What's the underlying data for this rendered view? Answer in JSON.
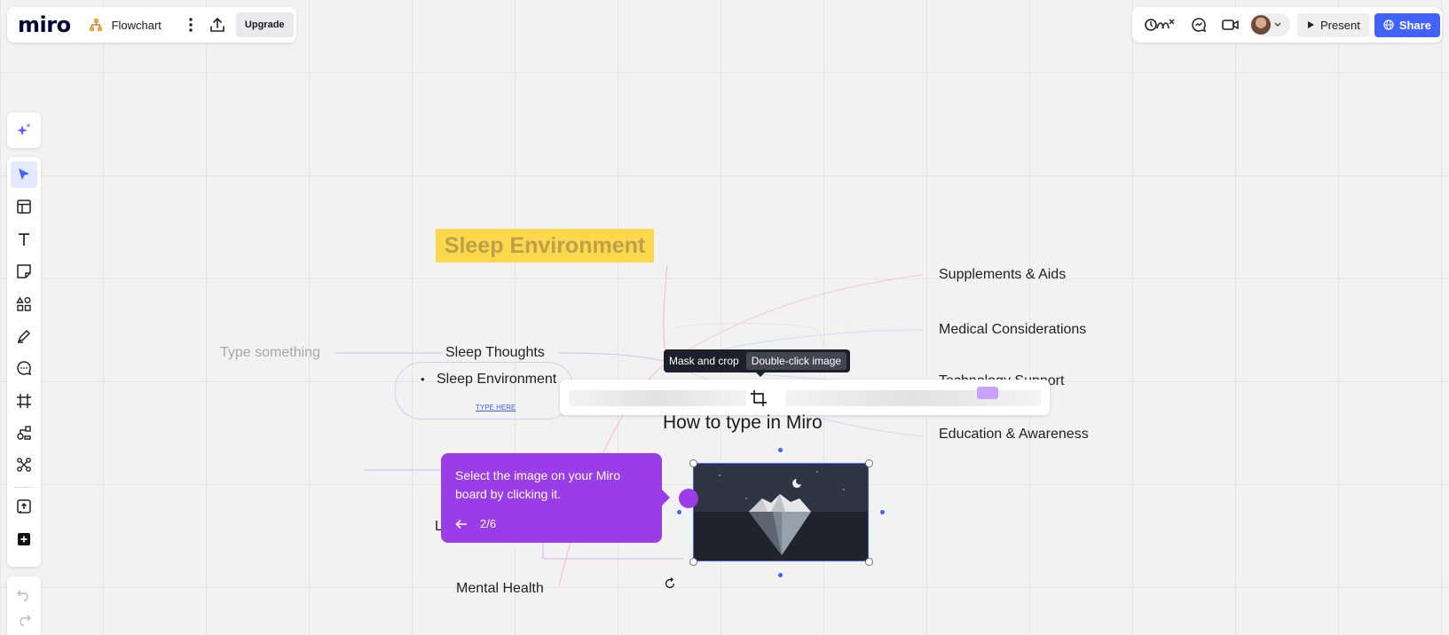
{
  "topbar": {
    "logo": "miro",
    "board_name": "Flowchart",
    "upgrade_label": "Upgrade",
    "present_label": "Present",
    "share_label": "Share"
  },
  "canvas": {
    "title": "Sleep Environment",
    "placeholder_node": "Type something",
    "nodes": {
      "sleep_thoughts": "Sleep Thoughts",
      "sleep_environment_bullet": "•",
      "sleep_environment": "Sleep Environment",
      "type_here": "TYPE HERE",
      "mental_health": "Mental Health",
      "partial_l": "L",
      "supplements": "Supplements & Aids",
      "medical": "Medical Considerations",
      "technology": "Technology Support",
      "education": "Education & Awareness"
    },
    "how_to_title": "How to type in Miro"
  },
  "tooltip": {
    "label": "Mask and crop",
    "hint": "Double-click image"
  },
  "guide": {
    "text": "Select the image on your Miro board by clicking it.",
    "step": "2/6"
  },
  "colors": {
    "accent": "#4262ff",
    "guide_purple": "#9b3ce9",
    "sticker_yellow": "#fcd94c"
  }
}
